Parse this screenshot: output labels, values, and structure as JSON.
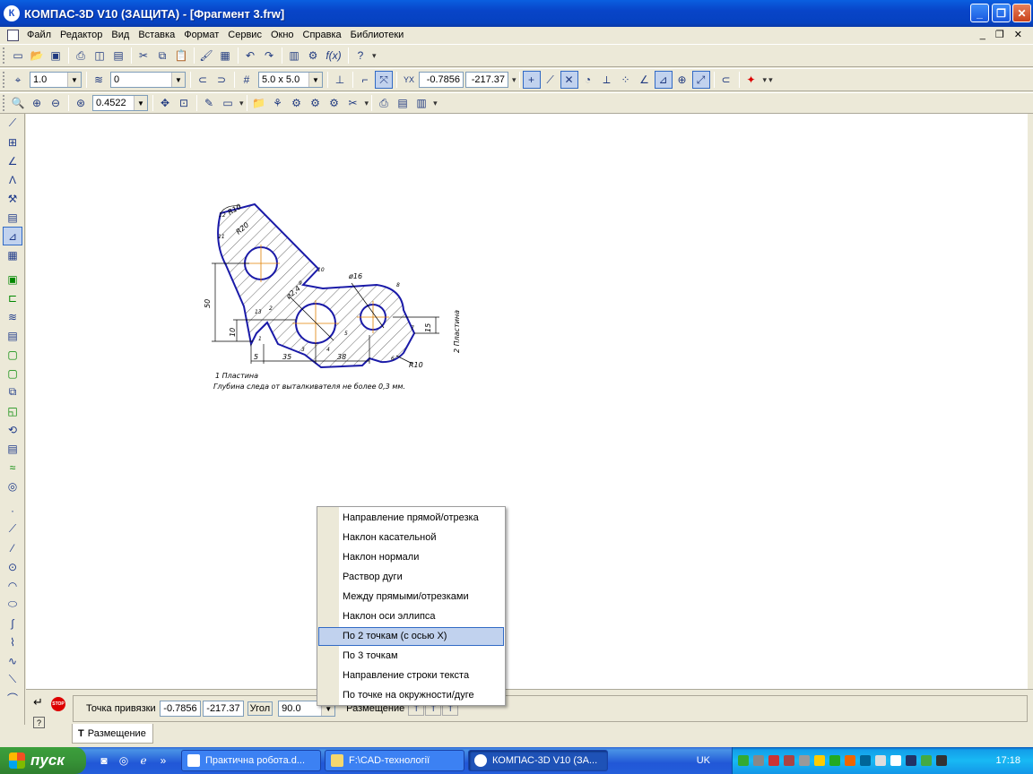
{
  "window": {
    "app_icon": "К",
    "title": "КОМПАС-3D V10 (ЗАЩИТА) - [Фрагмент 3.frw]",
    "minimize": "_",
    "maximize": "❐",
    "close": "✕",
    "mdi_controls": "_ ❐ ✕"
  },
  "menu": [
    "Файл",
    "Редактор",
    "Вид",
    "Вставка",
    "Формат",
    "Сервис",
    "Окно",
    "Справка",
    "Библиотеки"
  ],
  "toolbar1": {
    "fx_label": "f(x)"
  },
  "toolbar2": {
    "step": "1.0",
    "layer": "0",
    "grid": "5.0 x 5.0",
    "coord_x": "-0.7856",
    "coord_y": "-217.37"
  },
  "toolbar3": {
    "zoom": "0.4522"
  },
  "drawing": {
    "dims": {
      "r10_top": "R10",
      "r20": "R20",
      "d16": "ø16",
      "d24": "ø2,4",
      "v50": "50",
      "v10": "10",
      "h5": "5",
      "h35": "35",
      "h38": "38",
      "v15": "15",
      "r10_bottom": "R10"
    },
    "points": [
      "12",
      "11",
      "10",
      "9",
      "8",
      "7",
      "6",
      "5",
      "4",
      "3",
      "2",
      "1",
      "13"
    ],
    "note1": "1 Пластина",
    "note2": "Глубина следа от выталкивателя не более 0,3 мм.",
    "note3": "2 Пластина"
  },
  "property_bar": {
    "snap_label": "Точка привязки",
    "snap_x": "-0.7856",
    "snap_y": "-217.37",
    "angle_label": "Угол",
    "angle_value": "90.0",
    "placement_label": "Размещение",
    "tab_label": "Размещение",
    "stop_label": "STOP"
  },
  "context_menu": [
    "Направление прямой/отрезка",
    "Наклон касательной",
    "Наклон нормали",
    "Раствор дуги",
    "Между прямыми/отрезками",
    "Наклон оси эллипса",
    "По 2 точкам (с осью X)",
    "По 3 точкам",
    "Направление строки текста",
    "По точке на окружности/дуге"
  ],
  "taskbar": {
    "start": "пуск",
    "tasks": [
      "Практична робота.d...",
      "F:\\CAD-технології",
      "КОМПАС-3D V10 (ЗА..."
    ],
    "lang": "UK",
    "clock": "17:18"
  }
}
